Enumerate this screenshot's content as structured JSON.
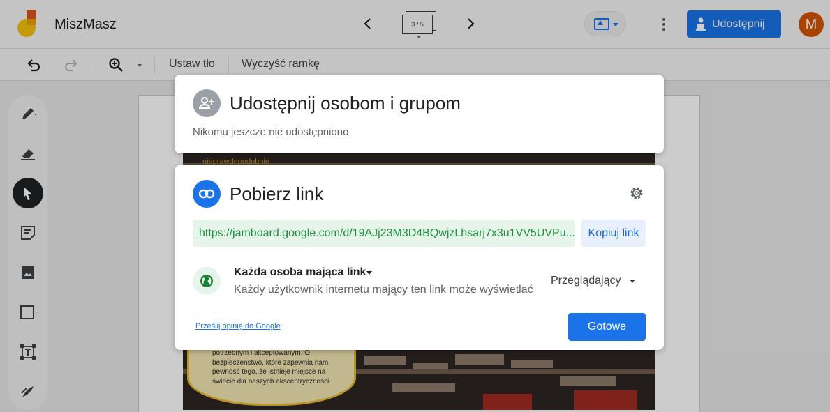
{
  "app": {
    "title": "MiszMasz",
    "frame_indicator": "3 / 5",
    "share_label": "Udostępnij",
    "avatar_letter": "M"
  },
  "toolbar": {
    "set_background": "Ustaw tło",
    "clear_frame": "Wyczyść ramkę"
  },
  "side_tools": [
    "pen-icon",
    "eraser-icon",
    "select-icon",
    "sticky-note-icon",
    "image-icon",
    "shape-icon",
    "text-box-icon",
    "laser-icon"
  ],
  "canvas": {
    "top_strip_text": "nieprawdopodobnie",
    "bubble_text": "potrzebnym i akceptowanym. O bezpieczeństwo, które zapewnia nam pewność tego, że istnieje miejsce na świecie dla naszych ekscentryczności."
  },
  "share_people": {
    "title": "Udostępnij osobom i grupom",
    "subtitle": "Nikomu jeszcze nie udostępniono"
  },
  "get_link": {
    "title": "Pobierz link",
    "url": "https://jamboard.google.com/d/19AJj23M3D4BQwjzLhsarj7x3u1VV5UVPu...",
    "copy_label": "Kopiuj link",
    "access_title": "Każda osoba mająca link",
    "access_desc": "Każdy użytkownik internetu mający ten link może wyświetlać",
    "role": "Przeglądający",
    "feedback": "Prześlij opinię do Google",
    "done": "Gotowe"
  },
  "colors": {
    "primary": "#1a73e8",
    "link_green": "#1e8e3e",
    "avatar": "#d35400"
  }
}
